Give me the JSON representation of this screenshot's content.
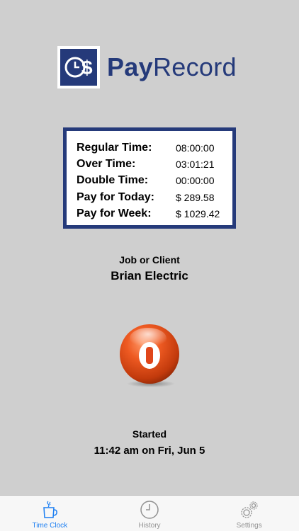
{
  "app": {
    "logo_pay": "Pay",
    "logo_record": "Record",
    "brand_color": "#253a7a"
  },
  "stats": [
    {
      "label": "Regular Time:",
      "value": "08:00:00"
    },
    {
      "label": "Over Time:",
      "value": "03:01:21"
    },
    {
      "label": "Double Time:",
      "value": "00:00:00"
    },
    {
      "label": "Pay for Today:",
      "value": "$ 289.58"
    },
    {
      "label": "Pay for Week:",
      "value": "$ 1029.42"
    }
  ],
  "job": {
    "label": "Job or Client",
    "value": "Brian Electric"
  },
  "clock_button": {
    "icon": "power-icon",
    "color": "#e0461a"
  },
  "started": {
    "label": "Started",
    "value": "11:42 am on Fri, Jun 5"
  },
  "tabs": [
    {
      "label": "Time Clock",
      "icon": "coffee-cup-icon",
      "active": true
    },
    {
      "label": "History",
      "icon": "clock-icon",
      "active": false
    },
    {
      "label": "Settings",
      "icon": "gears-icon",
      "active": false
    }
  ],
  "colors": {
    "background": "#cfcfcf",
    "tab_active": "#1d7ff2",
    "tab_inactive": "#929292"
  }
}
